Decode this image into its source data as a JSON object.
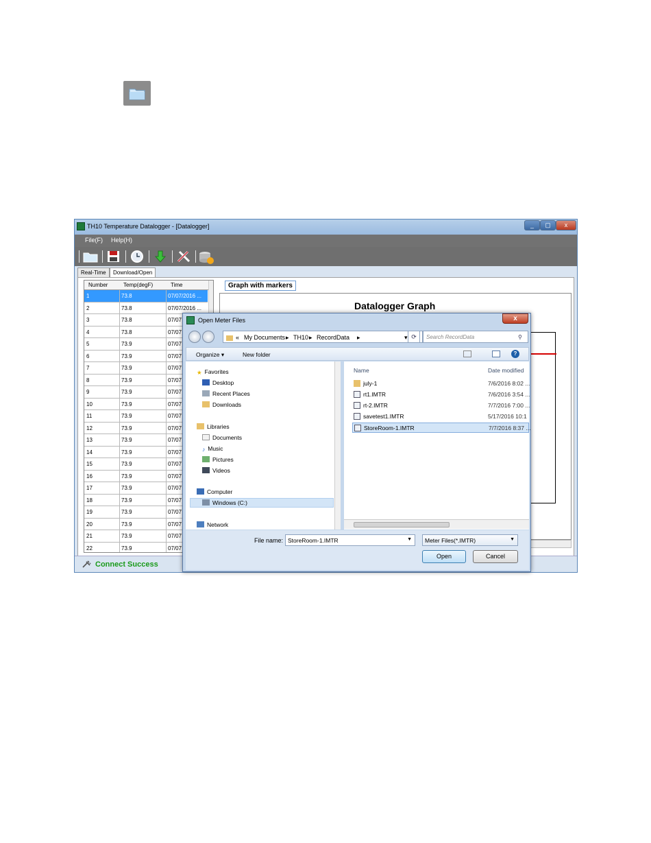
{
  "window": {
    "title": "TH10 Temperature Datalogger - [Datalogger]",
    "buttons": {
      "min": "_",
      "max": "▢",
      "close": "x"
    }
  },
  "menu": {
    "file": "File(F)",
    "help": "Help(H)"
  },
  "tabs": {
    "realtime": "Real-Time",
    "download": "Download/Open"
  },
  "table": {
    "headers": [
      "Number",
      "Temp(degF)",
      "Time"
    ],
    "rows": [
      [
        "1",
        "73.8",
        "07/07/2016 ..."
      ],
      [
        "2",
        "73.8",
        "07/07/2016 ..."
      ],
      [
        "3",
        "73.8",
        "07/07"
      ],
      [
        "4",
        "73.8",
        "07/07"
      ],
      [
        "5",
        "73.9",
        "07/07"
      ],
      [
        "6",
        "73.9",
        "07/07"
      ],
      [
        "7",
        "73.9",
        "07/07"
      ],
      [
        "8",
        "73.9",
        "07/07"
      ],
      [
        "9",
        "73.9",
        "07/07"
      ],
      [
        "10",
        "73.9",
        "07/07"
      ],
      [
        "11",
        "73.9",
        "07/07"
      ],
      [
        "12",
        "73.9",
        "07/07"
      ],
      [
        "13",
        "73.9",
        "07/07"
      ],
      [
        "14",
        "73.9",
        "07/07"
      ],
      [
        "15",
        "73.9",
        "07/07"
      ],
      [
        "16",
        "73.9",
        "07/07"
      ],
      [
        "17",
        "73.9",
        "07/07"
      ],
      [
        "18",
        "73.9",
        "07/07"
      ],
      [
        "19",
        "73.9",
        "07/07"
      ],
      [
        "20",
        "73.9",
        "07/07"
      ],
      [
        "21",
        "73.9",
        "07/07"
      ],
      [
        "22",
        "73.9",
        "07/07"
      ]
    ]
  },
  "graph": {
    "tab_label": "Graph with markers",
    "title": "Datalogger Graph"
  },
  "status": {
    "text": "Connect Success"
  },
  "dialog": {
    "title": "Open Meter Files",
    "close": "x",
    "address": {
      "prefix": "«",
      "parts": [
        "My Documents",
        "TH10",
        "RecordData"
      ]
    },
    "search_placeholder": "Search RecordData",
    "commands": {
      "organize": "Organize ▾",
      "new_folder": "New folder"
    },
    "nav": {
      "favorites": "Favorites",
      "desktop": "Desktop",
      "recent": "Recent Places",
      "downloads": "Downloads",
      "libraries": "Libraries",
      "documents": "Documents",
      "music": "Music",
      "pictures": "Pictures",
      "videos": "Videos",
      "computer": "Computer",
      "windows": "Windows (C:)",
      "network": "Network"
    },
    "columns": {
      "name": "Name",
      "date": "Date modified"
    },
    "files": [
      {
        "name": "july-1",
        "date": "7/6/2016 8:02 ..."
      },
      {
        "name": "rt1.IMTR",
        "date": "7/6/2016 3:54 ..."
      },
      {
        "name": "rt-2.IMTR",
        "date": "7/7/2016 7:00 ..."
      },
      {
        "name": "savetest1.IMTR",
        "date": "5/17/2016 10:1"
      },
      {
        "name": "StoreRoom-1.IMTR",
        "date": "7/7/2016 8:37 ..."
      }
    ],
    "file_name_label": "File name:",
    "file_name_value": "StoreRoom-1.IMTR",
    "file_type": "Meter Files(*.IMTR)",
    "open": "Open",
    "cancel": "Cancel"
  }
}
